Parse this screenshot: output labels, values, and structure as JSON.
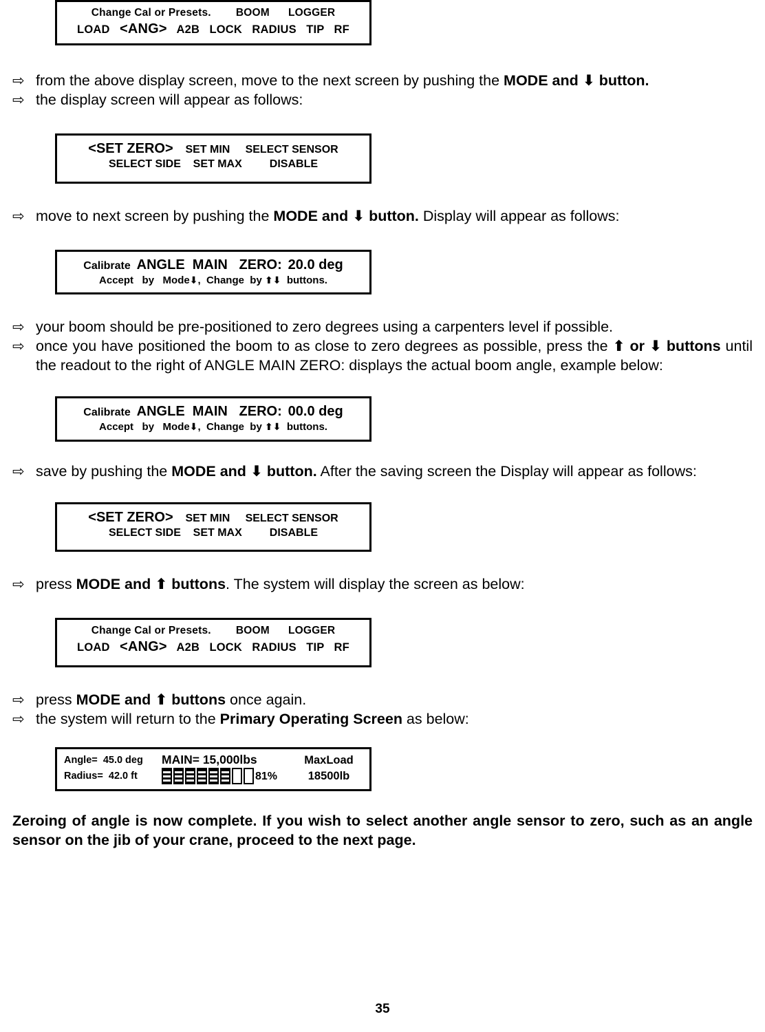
{
  "page_number": "35",
  "icons": {
    "bullet": "⇨",
    "arrow_up": "⬆",
    "arrow_down": "⬇",
    "arrow_up_small": "⬆",
    "arrow_down_small": "⬇"
  },
  "screens": {
    "change_cal_1": {
      "line1_a": "Change Cal or Presets.",
      "line1_b": "BOOM",
      "line1_c": "LOGGER",
      "line2_a": "LOAD",
      "line2_selected": "<ANG>",
      "line2_b": "A2B",
      "line2_c": "LOCK",
      "line2_d": "RADIUS",
      "line2_e": "TIP",
      "line2_f": "RF"
    },
    "set_zero_1": {
      "selected": "<SET ZERO>",
      "item2": "SET MIN",
      "item3": "SELECT SENSOR",
      "item4": "SELECT SIDE",
      "item5": "SET MAX",
      "item6": "DISABLE"
    },
    "calibrate_20": {
      "label": "Calibrate",
      "title": "ANGLE  MAIN   ZERO:",
      "value": "20.0 deg",
      "hint_a": "Accept   by   Mode",
      "hint_b": ",  Change  by",
      "hint_c": "buttons."
    },
    "calibrate_00": {
      "label": "Calibrate",
      "title": "ANGLE  MAIN   ZERO:",
      "value": "00.0 deg",
      "hint_a": "Accept   by   Mode",
      "hint_b": ",  Change  by",
      "hint_c": "buttons."
    },
    "set_zero_2": {
      "selected": "<SET ZERO>",
      "item2": "SET MIN",
      "item3": "SELECT SENSOR",
      "item4": "SELECT SIDE",
      "item5": "SET MAX",
      "item6": "DISABLE"
    },
    "change_cal_2": {
      "line1_a": "Change Cal or Presets.",
      "line1_b": "BOOM",
      "line1_c": "LOGGER",
      "line2_a": "LOAD",
      "line2_selected": "<ANG>",
      "line2_b": "A2B",
      "line2_c": "LOCK",
      "line2_d": "RADIUS",
      "line2_e": "TIP",
      "line2_f": "RF"
    },
    "primary_operating": {
      "angle_label": "Angle=",
      "angle_value": "45.0 deg",
      "radius_label": "Radius=",
      "radius_value": "42.0 ft",
      "main_label": "MAIN=",
      "main_value": "15,000lbs",
      "max_load_label": "MaxLoad",
      "max_load_value": "18500lb",
      "percent": "81%",
      "bar_segments_total": 8,
      "bar_segments_filled": 6
    }
  },
  "instructions": {
    "b1": "from the above display screen, move to the next screen by pushing the ",
    "b1_bold_a": "MODE and ",
    "b1_bold_b": " button.",
    "b2": "the display screen will appear as follows:",
    "b3_a": "move to next screen by pushing the ",
    "b3_bold_a": "MODE and ",
    "b3_bold_b": " button.",
    "b3_b": "   Display will appear as follows:",
    "b4": "your boom should be pre-positioned to zero degrees using a carpenters level if possible.",
    "b5_a": "once you have positioned the boom to as close to zero degrees as possible,  press the ",
    "b5_bold_or": " or ",
    "b5_bold_buttons": "buttons",
    "b5_b": " until the readout to the right of ANGLE MAIN ZERO: displays the actual boom angle, example below:",
    "b6_a": "save by pushing the ",
    "b6_bold_a": "MODE and ",
    "b6_bold_b": " button.",
    "b6_b": "    After the saving screen the Display will appear as follows:",
    "b7_a": "press ",
    "b7_bold_a": "MODE and ",
    "b7_bold_b": " buttons",
    "b7_b": ".  The system will display the screen as below:",
    "b8_a": "press ",
    "b8_bold_a": "MODE and ",
    "b8_bold_b": " buttons",
    "b8_b": " once again.",
    "b9_a": "the system will return to the ",
    "b9_bold": "Primary Operating Screen",
    "b9_b": " as below:"
  },
  "closing": {
    "text": "Zeroing of angle is now complete.   If you wish to select another angle sensor to zero, such as an angle sensor on the jib of your crane, proceed to the next page."
  }
}
